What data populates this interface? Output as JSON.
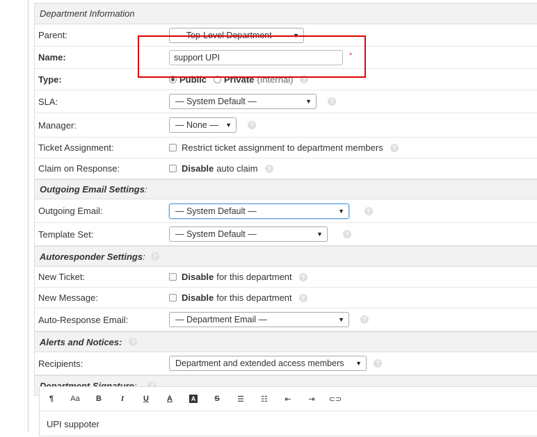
{
  "sections": {
    "dept_info": "Department Information",
    "outgoing": "Outgoing Email Settings",
    "autoresponder": "Autoresponder Settings",
    "alerts": "Alerts and Notices:",
    "signature": "Department Signature"
  },
  "fields": {
    "parent": {
      "label": "Parent:",
      "value": "— Top-Level Department —"
    },
    "name": {
      "label": "Name:",
      "value": "support UPI",
      "required": "*"
    },
    "type": {
      "label": "Type:",
      "opt_public": "Public",
      "opt_private": "Private",
      "opt_private_hint": "(Internal)"
    },
    "sla": {
      "label": "SLA:",
      "value": "— System Default —"
    },
    "manager": {
      "label": "Manager:",
      "value": "— None —"
    },
    "ticket_assignment": {
      "label": "Ticket Assignment:",
      "text": "Restrict ticket assignment to department members"
    },
    "claim": {
      "label": "Claim on Response:",
      "bold": "Disable",
      "text": "auto claim"
    },
    "outgoing_email": {
      "label": "Outgoing Email:",
      "value": "— System Default —"
    },
    "template_set": {
      "label": "Template Set:",
      "value": "— System Default —"
    },
    "new_ticket": {
      "label": "New Ticket:",
      "bold": "Disable",
      "text": "for this department"
    },
    "new_message": {
      "label": "New Message:",
      "bold": "Disable",
      "text": "for this department"
    },
    "auto_response_email": {
      "label": "Auto-Response Email:",
      "value": "— Department Email —"
    },
    "recipients": {
      "label": "Recipients:",
      "value": "Department and extended access members"
    }
  },
  "editor": {
    "toolbar": [
      "¶",
      "Aa",
      "B",
      "I",
      "U",
      "A",
      "A",
      "S",
      "list",
      "numlist",
      "outdent",
      "indent",
      "link"
    ],
    "content": "UPI suppoter"
  }
}
